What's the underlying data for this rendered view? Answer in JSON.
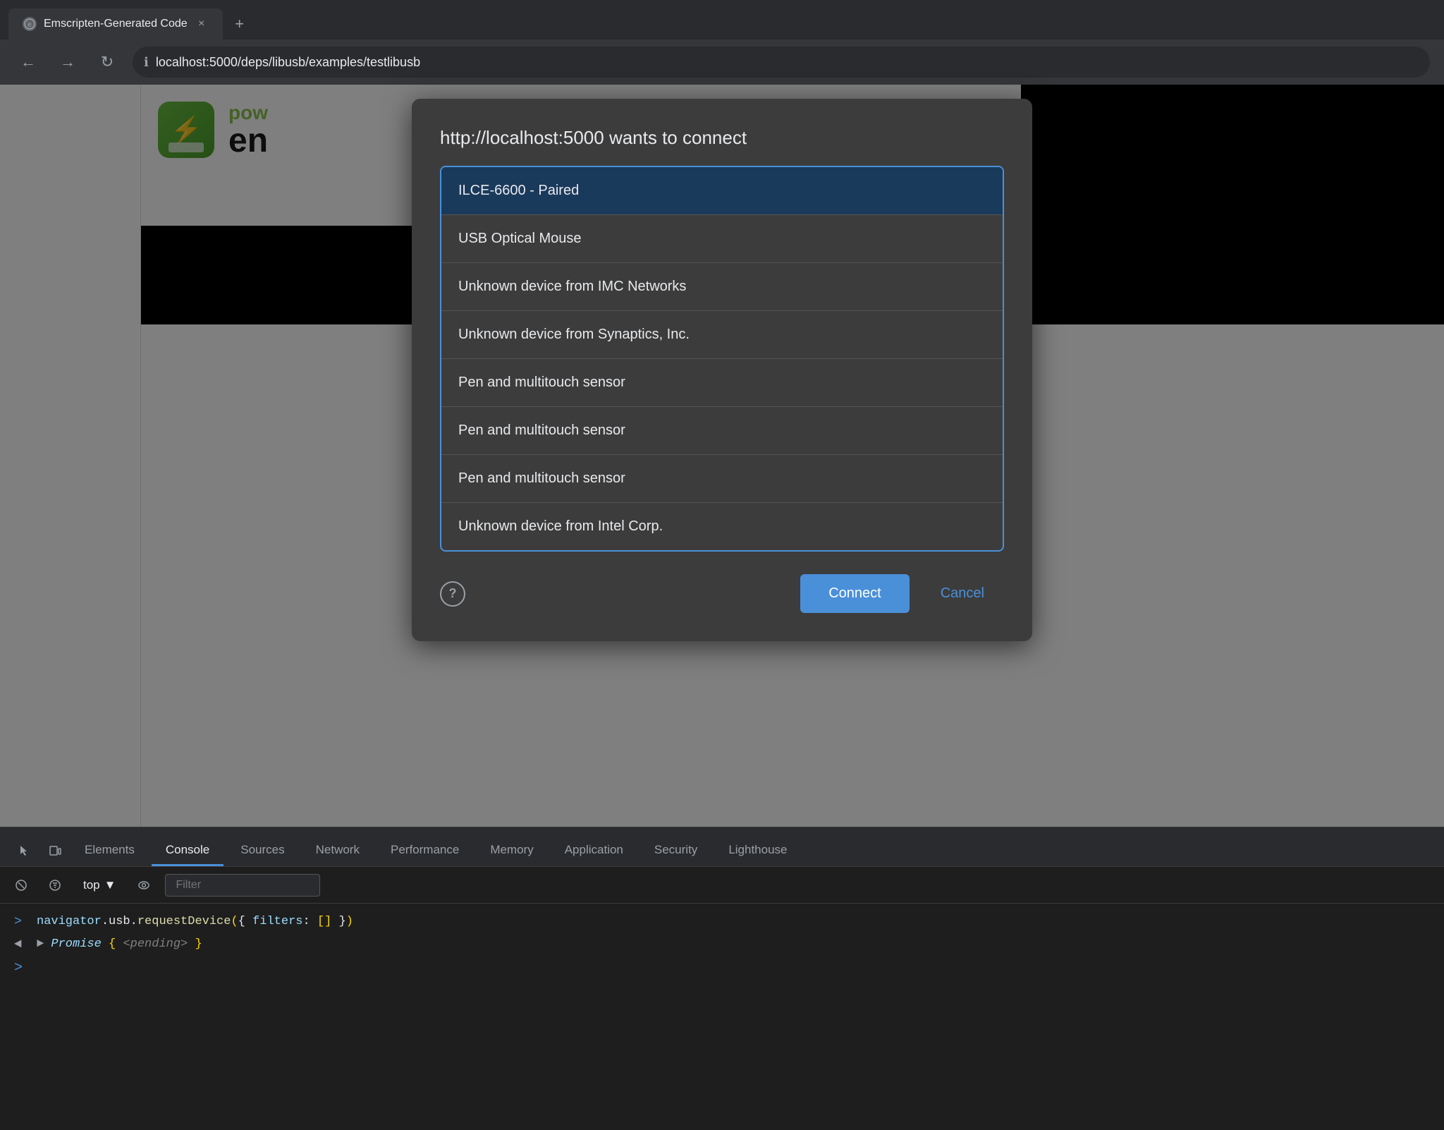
{
  "browser": {
    "tab": {
      "title": "Emscripten-Generated Code",
      "close_label": "×",
      "new_tab_label": "+"
    },
    "nav": {
      "back_label": "←",
      "forward_label": "→",
      "reload_label": "↻",
      "url": "localhost:5000/deps/libusb/examples/testlibusb"
    }
  },
  "dialog": {
    "title": "http://localhost:5000 wants to connect",
    "devices": [
      {
        "name": "ILCE-6600 - Paired",
        "selected": true
      },
      {
        "name": "USB Optical Mouse",
        "selected": false
      },
      {
        "name": "Unknown device from IMC Networks",
        "selected": false
      },
      {
        "name": "Unknown device from Synaptics, Inc.",
        "selected": false
      },
      {
        "name": "Pen and multitouch sensor",
        "selected": false
      },
      {
        "name": "Pen and multitouch sensor",
        "selected": false
      },
      {
        "name": "Pen and multitouch sensor",
        "selected": false
      },
      {
        "name": "Unknown device from Intel Corp.",
        "selected": false
      }
    ],
    "connect_label": "Connect",
    "cancel_label": "Cancel",
    "help_label": "?"
  },
  "devtools": {
    "tabs": [
      {
        "label": "Elements",
        "active": false
      },
      {
        "label": "Console",
        "active": true
      },
      {
        "label": "Sources",
        "active": false
      },
      {
        "label": "Network",
        "active": false
      },
      {
        "label": "Performance",
        "active": false
      },
      {
        "label": "Memory",
        "active": false
      },
      {
        "label": "Application",
        "active": false
      },
      {
        "label": "Security",
        "active": false
      },
      {
        "label": "Lighthouse",
        "active": false
      }
    ],
    "toolbar": {
      "context_label": "top",
      "filter_placeholder": "Filter"
    },
    "console": {
      "input_line": "navigator.usb.requestDevice({ filters: [] })",
      "output_line1_prefix": "◄ ",
      "output_line1_promise": "▶ Promise ",
      "output_line1_pending": "{<pending>}",
      "cursor": ">"
    }
  },
  "app": {
    "icon_label": "⚡",
    "title_part1": "pow",
    "title_part2": "en"
  }
}
